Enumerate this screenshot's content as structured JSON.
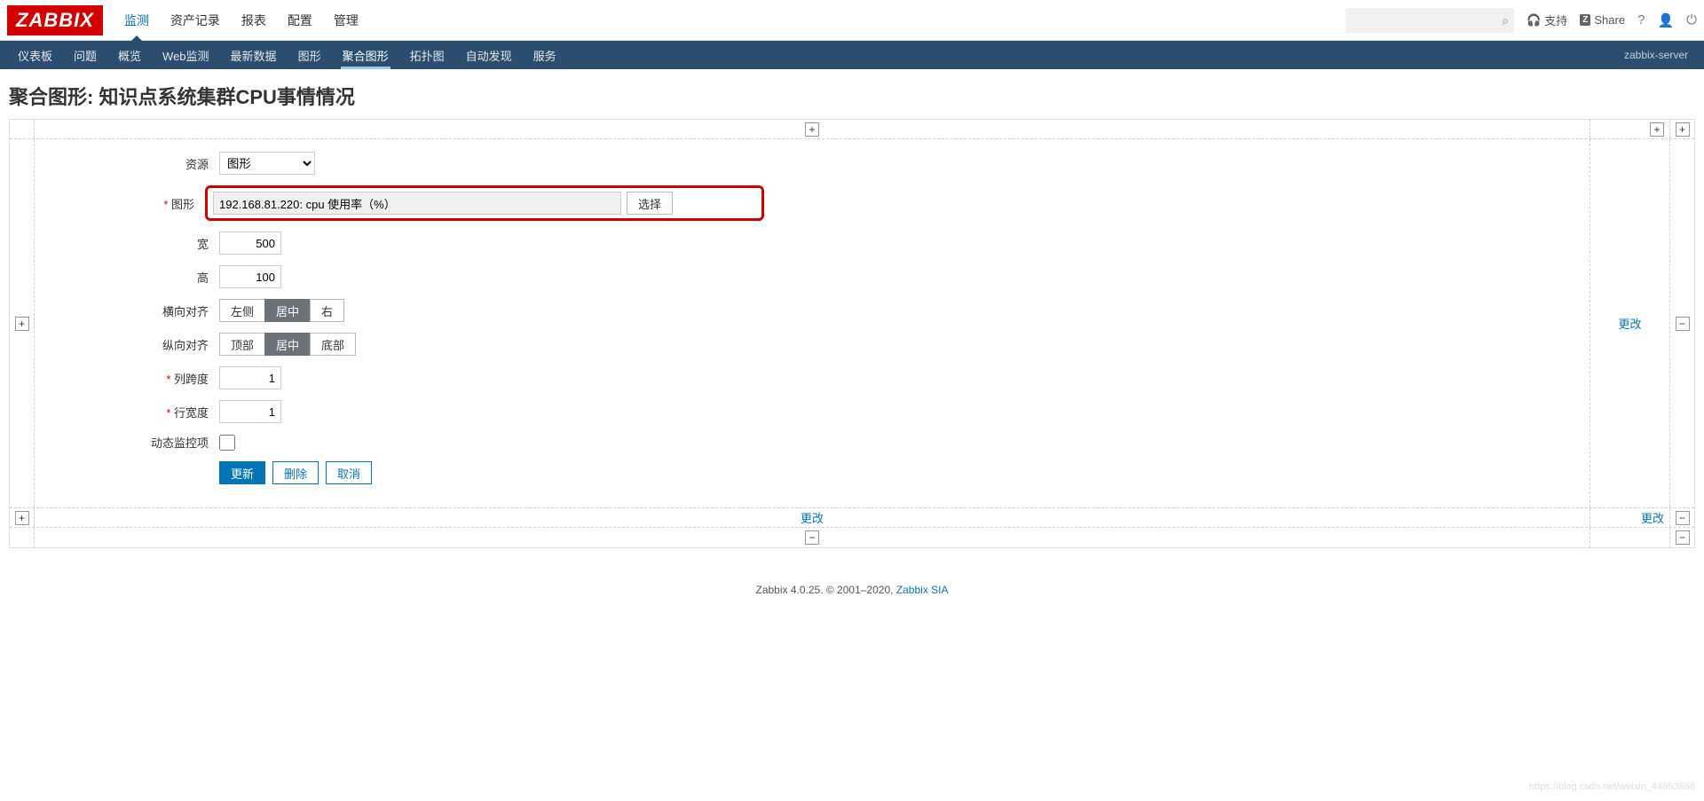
{
  "logo": "ZABBIX",
  "topnav": [
    "监测",
    "资产记录",
    "报表",
    "配置",
    "管理"
  ],
  "topnav_active": 0,
  "support_label": "支持",
  "share_label": "Share",
  "subnav": [
    "仪表板",
    "问题",
    "概览",
    "Web监测",
    "最新数据",
    "图形",
    "聚合图形",
    "拓扑图",
    "自动发现",
    "服务"
  ],
  "subnav_active": 6,
  "server_label": "zabbix-server",
  "page_title": "聚合图形: 知识点系统集群CPU事情情况",
  "change_label": "更改",
  "form": {
    "resource_label": "资源",
    "resource_value": "图形",
    "graph_label": "图形",
    "graph_value": "192.168.81.220: cpu 使用率（%）",
    "select_btn": "选择",
    "width_label": "宽",
    "width_value": "500",
    "height_label": "高",
    "height_value": "100",
    "halign_label": "横向对齐",
    "halign_opts": [
      "左侧",
      "居中",
      "右"
    ],
    "halign_sel": 1,
    "valign_label": "纵向对齐",
    "valign_opts": [
      "顶部",
      "居中",
      "底部"
    ],
    "valign_sel": 1,
    "colspan_label": "列跨度",
    "colspan_value": "1",
    "rowspan_label": "行宽度",
    "rowspan_value": "1",
    "dynamic_label": "动态监控项",
    "update_btn": "更新",
    "delete_btn": "删除",
    "cancel_btn": "取消"
  },
  "footer": {
    "text": "Zabbix 4.0.25. © 2001–2020, ",
    "link": "Zabbix SIA"
  },
  "watermark": "https://blog.csdn.net/weixin_44953658"
}
